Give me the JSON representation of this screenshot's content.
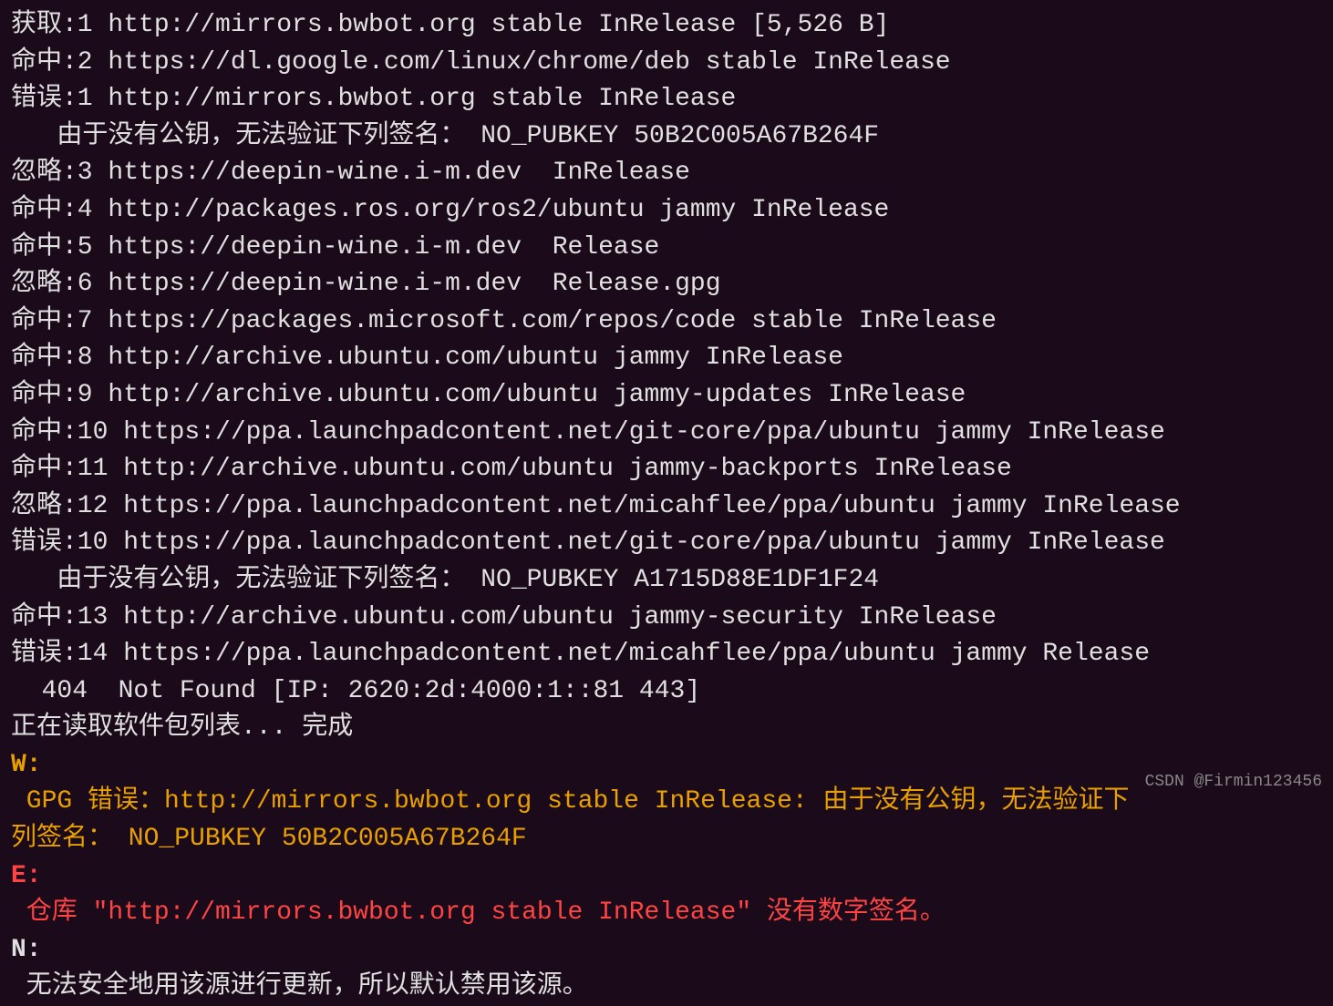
{
  "terminal": {
    "background": "#1a0a1a",
    "lines": [
      {
        "id": "line1",
        "type": "normal",
        "text": "获取:1 http://mirrors.bwbot.org stable InRelease [5,526 B]"
      },
      {
        "id": "line2",
        "type": "normal",
        "text": "命中:2 https://dl.google.com/linux/chrome/deb stable InRelease"
      },
      {
        "id": "line3",
        "type": "normal",
        "text": "错误:1 http://mirrors.bwbot.org stable InRelease"
      },
      {
        "id": "line4",
        "type": "normal",
        "text": "   由于没有公钥，无法验证下列签名： NO_PUBKEY 50B2C005A67B264F"
      },
      {
        "id": "line5",
        "type": "normal",
        "text": "忽略:3 https://deepin-wine.i-m.dev  InRelease"
      },
      {
        "id": "line6",
        "type": "normal",
        "text": "命中:4 http://packages.ros.org/ros2/ubuntu jammy InRelease"
      },
      {
        "id": "line7",
        "type": "normal",
        "text": "命中:5 https://deepin-wine.i-m.dev  Release"
      },
      {
        "id": "line8",
        "type": "normal",
        "text": "忽略:6 https://deepin-wine.i-m.dev  Release.gpg"
      },
      {
        "id": "line9",
        "type": "normal",
        "text": "命中:7 https://packages.microsoft.com/repos/code stable InRelease"
      },
      {
        "id": "line10",
        "type": "normal",
        "text": "命中:8 http://archive.ubuntu.com/ubuntu jammy InRelease"
      },
      {
        "id": "line11",
        "type": "normal",
        "text": "命中:9 http://archive.ubuntu.com/ubuntu jammy-updates InRelease"
      },
      {
        "id": "line12",
        "type": "normal",
        "text": "命中:10 https://ppa.launchpadcontent.net/git-core/ppa/ubuntu jammy InRelease"
      },
      {
        "id": "line13",
        "type": "normal",
        "text": "命中:11 http://archive.ubuntu.com/ubuntu jammy-backports InRelease"
      },
      {
        "id": "line14",
        "type": "normal",
        "text": "忽略:12 https://ppa.launchpadcontent.net/micahflee/ppa/ubuntu jammy InRelease"
      },
      {
        "id": "line15",
        "type": "normal",
        "text": "错误:10 https://ppa.launchpadcontent.net/git-core/ppa/ubuntu jammy InRelease"
      },
      {
        "id": "line16",
        "type": "normal",
        "text": "   由于没有公钥，无法验证下列签名： NO_PUBKEY A1715D88E1DF1F24"
      },
      {
        "id": "line17",
        "type": "normal",
        "text": "命中:13 http://archive.ubuntu.com/ubuntu jammy-security InRelease"
      },
      {
        "id": "line18",
        "type": "normal",
        "text": "错误:14 https://ppa.launchpadcontent.net/micahflee/ppa/ubuntu jammy Release"
      },
      {
        "id": "line19",
        "type": "normal",
        "text": "  404  Not Found [IP: 2620:2d:4000:1::81 443]"
      },
      {
        "id": "line20",
        "type": "normal",
        "text": "正在读取软件包列表... 完成"
      },
      {
        "id": "line21",
        "type": "warning",
        "prefix": "W:",
        "text": " GPG 错误：http://mirrors.bwbot.org stable InRelease: 由于没有公钥，无法验证下\n列签名： NO_PUBKEY 50B2C005A67B264F"
      },
      {
        "id": "line22",
        "type": "error",
        "prefix": "E:",
        "text": " 仓库 \"http://mirrors.bwbot.org stable InRelease\" 没有数字签名。"
      },
      {
        "id": "line23",
        "type": "info",
        "prefix": "N:",
        "text": " 无法安全地用该源进行更新，所以默认禁用该源。"
      }
    ],
    "watermark": "CSDN @Firmin123456"
  }
}
